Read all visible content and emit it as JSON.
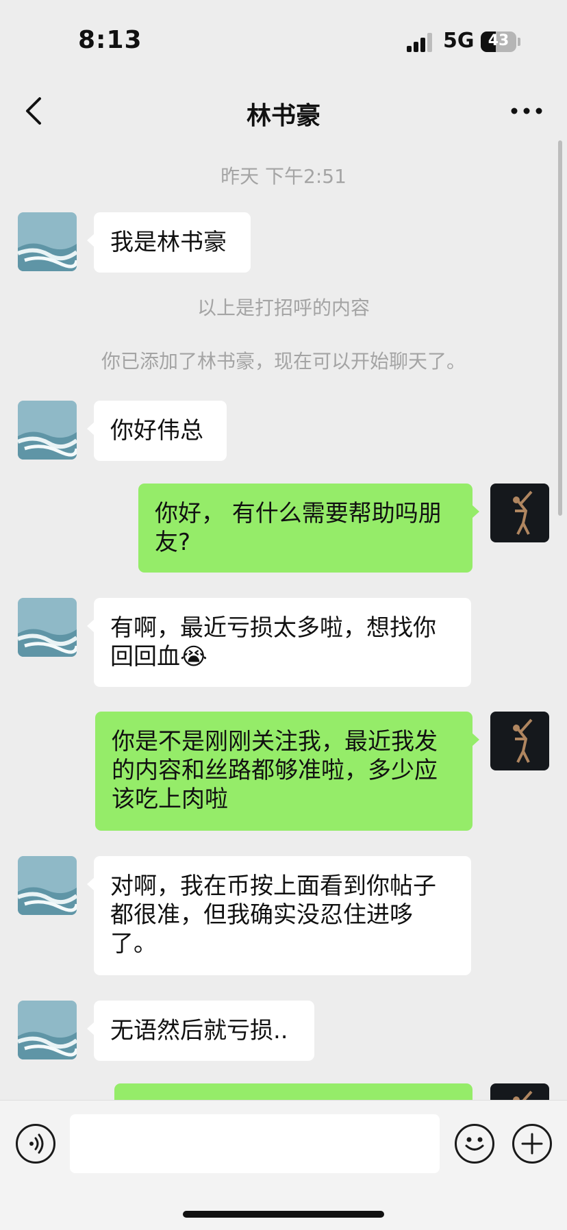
{
  "status_bar": {
    "time": "8:13",
    "network": "5G",
    "battery": "43",
    "battery_level": 0.43
  },
  "header": {
    "title": "林书豪",
    "back_icon": "chevron-left-icon",
    "more_icon": "more-dots-icon"
  },
  "chat": {
    "timestamp": "昨天 下午2:51",
    "system_notes": [
      "以上是打招呼的内容",
      "你已添加了林书豪，现在可以开始聊天了。"
    ],
    "messages": [
      {
        "side": "left",
        "text": "我是林书豪"
      },
      {
        "side": "left",
        "text": "你好伟总"
      },
      {
        "side": "right",
        "text": "你好， 有什么需要帮助吗朋友?"
      },
      {
        "side": "left",
        "text": "有啊，最近亏损太多啦，想找你回回血😭"
      },
      {
        "side": "right",
        "text": "你是不是刚刚关注我，最近我发的内容和丝路都够准啦，多少应该吃上肉啦"
      },
      {
        "side": "left",
        "text": "对啊，我在币按上面看到你帖子都很准，但我确实没忍住进哆了。"
      },
      {
        "side": "left",
        "text": "无语然后就亏损.."
      },
      {
        "side": "right",
        "text": ""
      }
    ]
  },
  "input_bar": {
    "voice_icon": "voice-icon",
    "emoji_icon": "emoji-icon",
    "plus_icon": "plus-icon",
    "input_value": ""
  },
  "colors": {
    "background": "#ededed",
    "bubble_left": "#ffffff",
    "bubble_right": "#95ec69",
    "system_text": "#a4a4a4"
  }
}
